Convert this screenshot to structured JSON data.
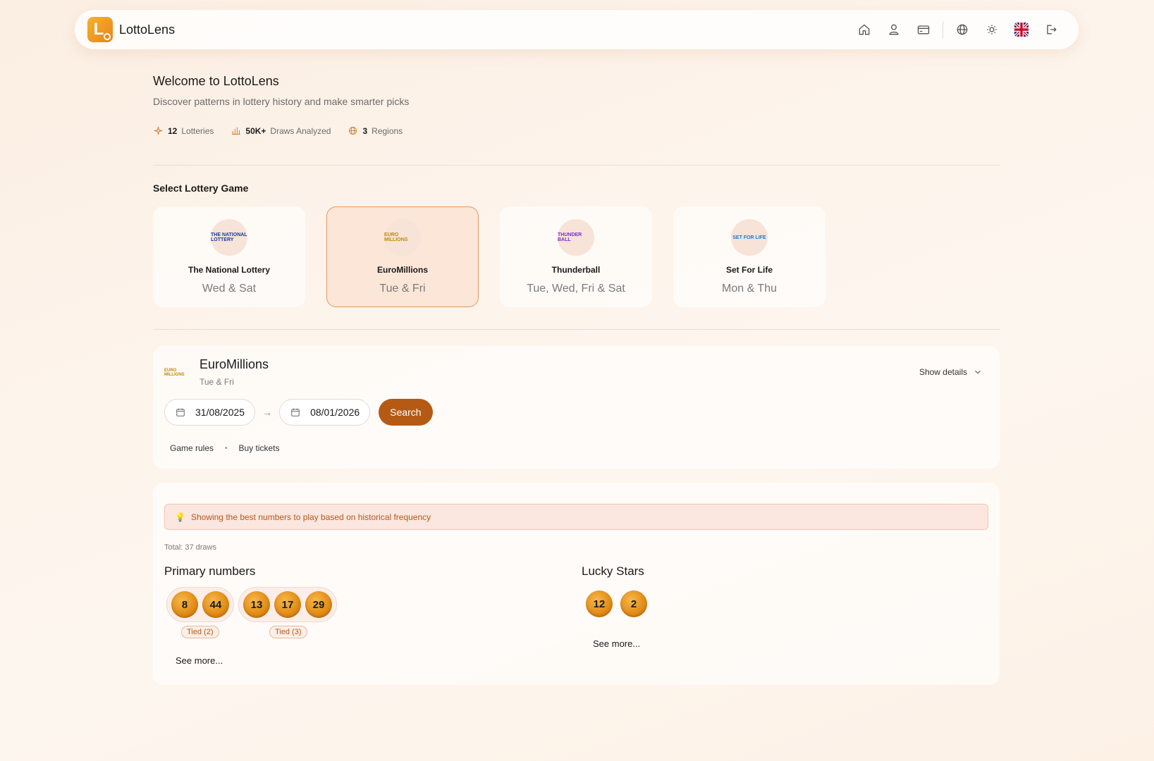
{
  "app": {
    "brand": "LottoLens",
    "logo_letter": "L"
  },
  "nav": {
    "icons": [
      "home-icon",
      "user-icon",
      "card-icon",
      "globe-icon",
      "sun-icon",
      "uk-flag-icon",
      "logout-icon"
    ]
  },
  "welcome": {
    "title": "Welcome to LottoLens",
    "subtitle": "Discover patterns in lottery history and make smarter picks",
    "stats": [
      {
        "value": "12",
        "label": "Lotteries",
        "icon": "sparkle-icon"
      },
      {
        "value": "50K+",
        "label": "Draws Analyzed",
        "icon": "bar-chart-icon"
      },
      {
        "value": "3",
        "label": "Regions",
        "icon": "globe-icon"
      }
    ]
  },
  "games": {
    "label": "Select Lottery Game",
    "items": [
      {
        "name": "The National Lottery",
        "days": "Wed & Sat",
        "logo_text": "THE NATIONAL LOTTERY",
        "logo_color": "#1a3aa0",
        "selected": false
      },
      {
        "name": "EuroMillions",
        "days": "Tue & Fri",
        "logo_text": "EURO MILLIONS",
        "logo_color": "#c28a00",
        "selected": true
      },
      {
        "name": "Thunderball",
        "days": "Tue, Wed, Fri & Sat",
        "logo_text": "THUNDER BALL",
        "logo_color": "#7a2cd4",
        "selected": false
      },
      {
        "name": "Set For Life",
        "days": "Mon & Thu",
        "logo_text": "SET FOR LIFE",
        "logo_color": "#1a7ad4",
        "selected": false
      }
    ]
  },
  "selected_game": {
    "name": "EuroMillions",
    "days": "Tue & Fri",
    "logo_text": "EURO MILLIONS",
    "show_details": "Show details",
    "date_from": "31/08/2025",
    "date_to": "08/01/2026",
    "search_label": "Search",
    "links": [
      "Game rules",
      "Buy tickets"
    ]
  },
  "results": {
    "notice": "Showing the best numbers to play based on historical frequency",
    "total": "Total: 37 draws",
    "primary": {
      "title": "Primary numbers",
      "groups": [
        {
          "balls": [
            "8",
            "44"
          ],
          "badge": "Tied (2)"
        },
        {
          "balls": [
            "13",
            "17",
            "29"
          ],
          "badge": "Tied (3)"
        }
      ],
      "see_more": "See more..."
    },
    "stars": {
      "title": "Lucky Stars",
      "balls": [
        "12",
        "2"
      ],
      "see_more": "See more..."
    }
  },
  "colors": {
    "accent": "#b55a14",
    "ball": "#e08a15",
    "selected_border": "#e29a5e"
  }
}
